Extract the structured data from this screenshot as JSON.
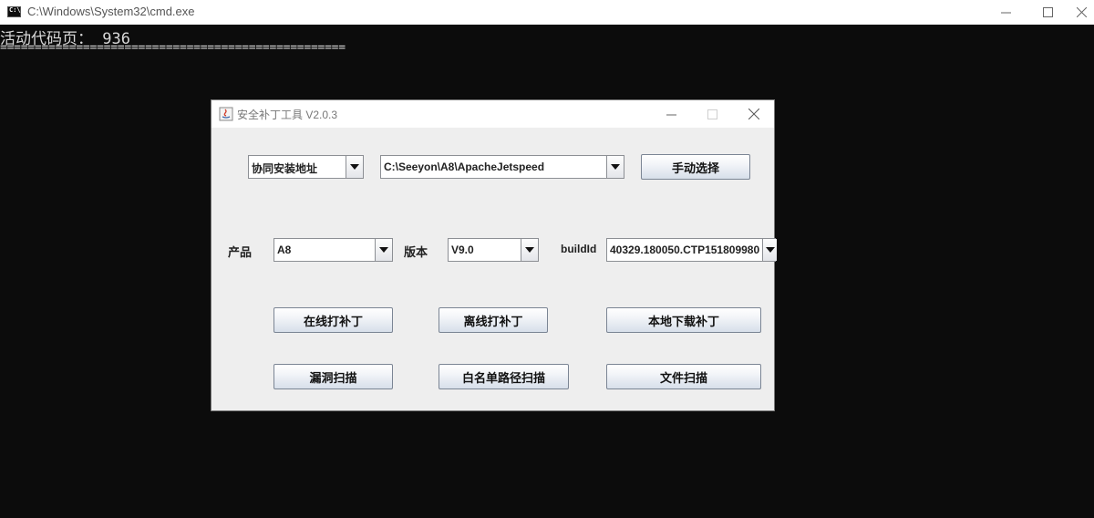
{
  "cmd": {
    "title": "C:\\Windows\\System32\\cmd.exe",
    "icon_text": "C:\\.",
    "line1": "活动代码页： 936",
    "line2": "=================================================="
  },
  "dialog": {
    "title": "安全补丁工具 V2.0.3",
    "row1": {
      "path_type": "协同安装地址",
      "path_value": "C:\\Seeyon\\A8\\ApacheJetspeed",
      "choose_button": "手动选择"
    },
    "row2": {
      "product_label": "产品",
      "product_value": "A8",
      "version_label": "版本",
      "version_value": "V9.0",
      "buildid_label": "buildId",
      "buildid_value": "40329.180050.CTP151809980"
    },
    "buttons": {
      "online_patch": "在线打补丁",
      "offline_patch": "离线打补丁",
      "local_download": "本地下载补丁",
      "vuln_scan": "漏洞扫描",
      "whitelist_scan": "白名单路径扫描",
      "file_scan": "文件扫描"
    }
  }
}
